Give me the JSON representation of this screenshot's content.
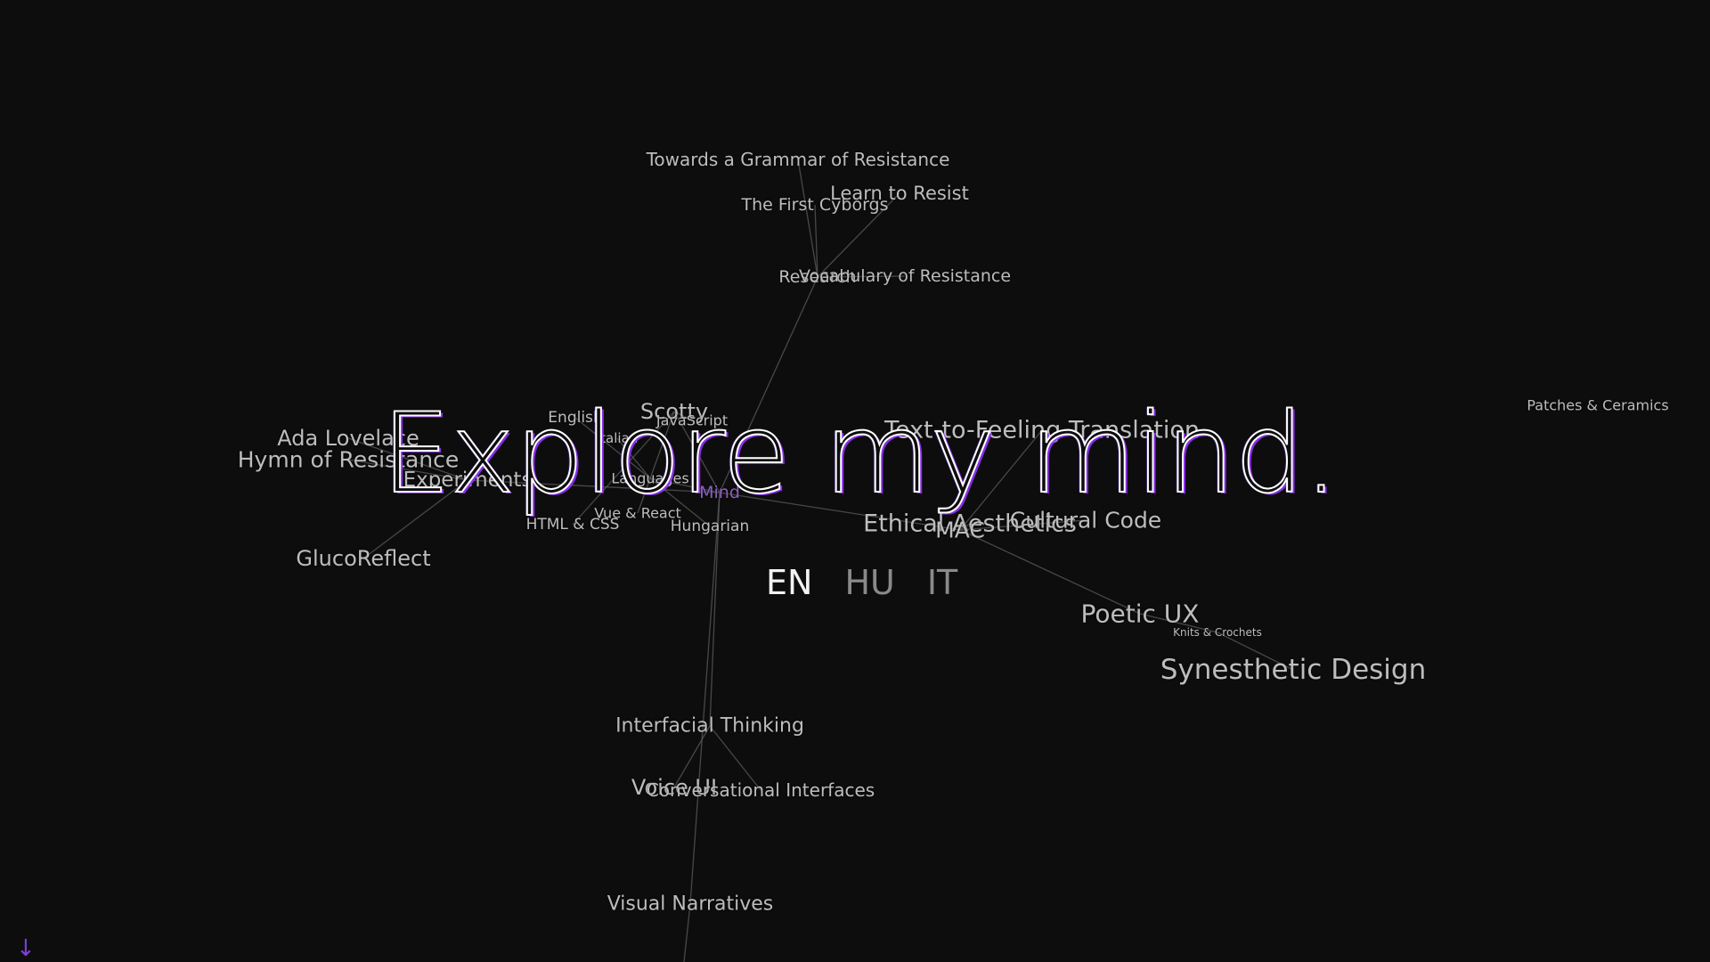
{
  "hero": {
    "title": "Explore my mind."
  },
  "languages": {
    "en": "EN",
    "hu": "HU",
    "it": "IT",
    "active": "EN"
  },
  "scroll_arrow": "↓",
  "colors": {
    "background": "#0d0d0d",
    "node_text": "#bdbdbd",
    "hub_text": "#8b5fbf",
    "accent": "#7b3fd6",
    "edge": "#5c5c5c"
  },
  "graph": {
    "nodes": [
      {
        "id": "mind",
        "label": "Mind"
      },
      {
        "id": "research",
        "label": "Research"
      },
      {
        "id": "towards-grammar",
        "label": "Towards a Grammar of Resistance"
      },
      {
        "id": "first-cyborgs",
        "label": "The First Cyborgs"
      },
      {
        "id": "learn-to-resist",
        "label": "Learn to Resist"
      },
      {
        "id": "vocabulary",
        "label": "Vocabulary of Resistance"
      },
      {
        "id": "scotty",
        "label": "Scotty"
      },
      {
        "id": "english",
        "label": "English"
      },
      {
        "id": "javascript",
        "label": "JavaScript"
      },
      {
        "id": "italian",
        "label": "Italian"
      },
      {
        "id": "languages",
        "label": "Languages"
      },
      {
        "id": "vue-react",
        "label": "Vue & React"
      },
      {
        "id": "html-css",
        "label": "HTML & CSS"
      },
      {
        "id": "hungarian",
        "label": "Hungarian"
      },
      {
        "id": "ada",
        "label": "Ada Lovelace"
      },
      {
        "id": "hymn",
        "label": "Hymn of Resistance"
      },
      {
        "id": "experiments",
        "label": "Experiments"
      },
      {
        "id": "glucoreflect",
        "label": "GlucoReflect"
      },
      {
        "id": "text-to-feeling",
        "label": "Text-to-Feeling Translation"
      },
      {
        "id": "ethical",
        "label": "Ethical Aesthetics"
      },
      {
        "id": "mac",
        "label": "MAC"
      },
      {
        "id": "cultural-code",
        "label": "Cultural Code"
      },
      {
        "id": "poetic-ux",
        "label": "Poetic UX"
      },
      {
        "id": "knits",
        "label": "Knits & Crochets"
      },
      {
        "id": "synesthetic",
        "label": "Synesthetic Design"
      },
      {
        "id": "patches",
        "label": "Patches & Ceramics"
      },
      {
        "id": "interfacial",
        "label": "Interfacial Thinking"
      },
      {
        "id": "voice-ui",
        "label": "Voice UI"
      },
      {
        "id": "conversational",
        "label": "Conversational Interfaces"
      },
      {
        "id": "visual-narratives",
        "label": "Visual Narratives"
      }
    ],
    "edges": [
      [
        "mind",
        "research"
      ],
      [
        "research",
        "towards-grammar"
      ],
      [
        "research",
        "first-cyborgs"
      ],
      [
        "research",
        "learn-to-resist"
      ],
      [
        "research",
        "vocabulary"
      ],
      [
        "mind",
        "languages"
      ],
      [
        "languages",
        "english"
      ],
      [
        "languages",
        "italian"
      ],
      [
        "languages",
        "hungarian"
      ],
      [
        "mind",
        "scotty"
      ],
      [
        "scotty",
        "javascript"
      ],
      [
        "scotty",
        "vue-react"
      ],
      [
        "scotty",
        "html-css"
      ],
      [
        "mind",
        "experiments"
      ],
      [
        "experiments",
        "ada"
      ],
      [
        "experiments",
        "hymn"
      ],
      [
        "experiments",
        "glucoreflect"
      ],
      [
        "mind",
        "mac"
      ],
      [
        "mac",
        "text-to-feeling"
      ],
      [
        "mac",
        "ethical"
      ],
      [
        "mac",
        "cultural-code"
      ],
      [
        "mac",
        "poetic-ux"
      ],
      [
        "poetic-ux",
        "knits"
      ],
      [
        "knits",
        "synesthetic"
      ],
      [
        "mind",
        "interfacial"
      ],
      [
        "interfacial",
        "voice-ui"
      ],
      [
        "interfacial",
        "conversational"
      ],
      [
        "mind",
        "visual-narratives"
      ]
    ]
  }
}
